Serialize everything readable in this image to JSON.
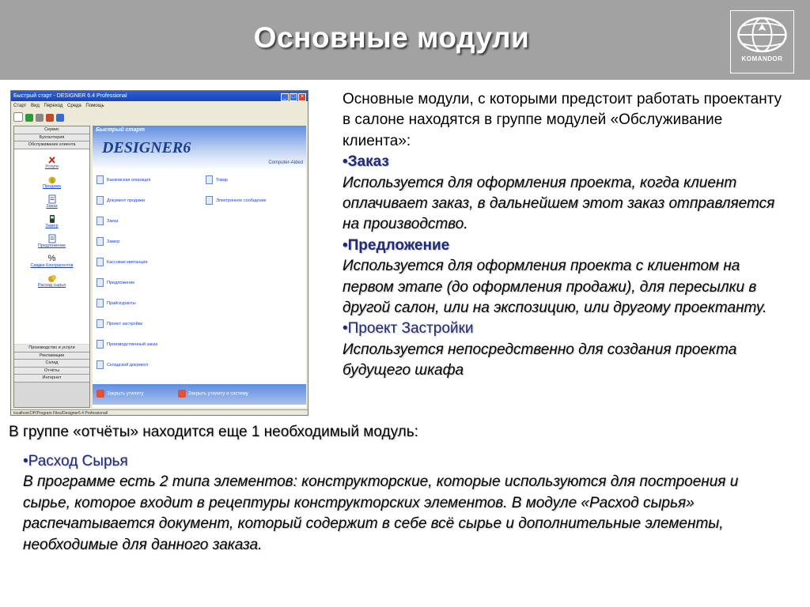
{
  "slide": {
    "title": "Основные модули",
    "logo_text": "KOMANDOR"
  },
  "app_screenshot": {
    "window_title": "Быстрый старт - DESIGNER 6.4 Professional",
    "menu": [
      "Старт",
      "Вид",
      "Переход",
      "Среда",
      "Помощь"
    ],
    "left_buttons_top": [
      "Сервис",
      "Бухгалтерия",
      "Обслуживание клиента"
    ],
    "left_icons": [
      {
        "label": "Услуги",
        "icon": "tools-icon"
      },
      {
        "label": "Продажа",
        "icon": "money-bag-icon"
      },
      {
        "label": "Заказ",
        "icon": "document-icon"
      },
      {
        "label": "Замер",
        "icon": "phone-icon"
      },
      {
        "label": "Предложение",
        "icon": "document-icon"
      },
      {
        "label": "Скидки Контрагентов",
        "icon": "percent-icon"
      },
      {
        "label": "Расход сырья",
        "icon": "coins-icon"
      }
    ],
    "left_buttons_bottom": [
      "Производство и услуги",
      "Рекламации",
      "Склад",
      "Отчёты",
      "Интернет"
    ],
    "banner_title": "Быстрый старт",
    "banner_brand": "DESIGNER",
    "banner_brand_num": "6",
    "banner_sub": "Computer-Aided",
    "main_items_col1": [
      "Банковская операция",
      "Документ продажи",
      "Заказ",
      "Замер",
      "Кассовая квитанция",
      "Предложение",
      "Прайскуранты",
      "Проект застройки",
      "Производственный заказ",
      "Складской документ"
    ],
    "main_items_col2": [
      "Товар",
      "Электронное сообщение"
    ],
    "footer_btn1": "Закрыть утилиту",
    "footer_btn2": "Закрыть утилиту и систему",
    "status": "localhost:DP/Program Files/Designer6.4 Professional/"
  },
  "right_text": {
    "intro": "Основные модули, с которыми предстоит работать проектанту в салоне находятся в группе модулей «Обслуживание клиента»:",
    "b1_title": "•Заказ",
    "b1_text": "Используется для оформления проекта, когда клиент оплачивает заказ, в дальнейшем этот заказ отправляется на производство.",
    "b2_title": "•Предложение",
    "b2_text": "Используется для оформления проекта с клиентом на первом этапе (до оформления продажи), для пересылки в другой салон, или на экспозицию, или другому проектанту.",
    "b3_title": "•Проект Застройки",
    "b3_text": "Используется непосредственно для создания проекта будущего шкафа"
  },
  "bottom": {
    "group_line": "В группе «отчёты» находится еще 1 необходимый модуль:",
    "b4_title": "•Расход Сырья",
    "b4_text": "В программе есть 2 типа элементов: конструкторские, которые используются для построения и сырье, которое входит в рецептуры конструкторских элементов. В модуле «Расход сырья» распечатывается документ, который содержит в себе всё сырье и дополнительные элементы, необходимые для данного заказа."
  },
  "colors": {
    "header_bg": "#a2a2a2",
    "bullet_title": "#1f2a7a"
  }
}
